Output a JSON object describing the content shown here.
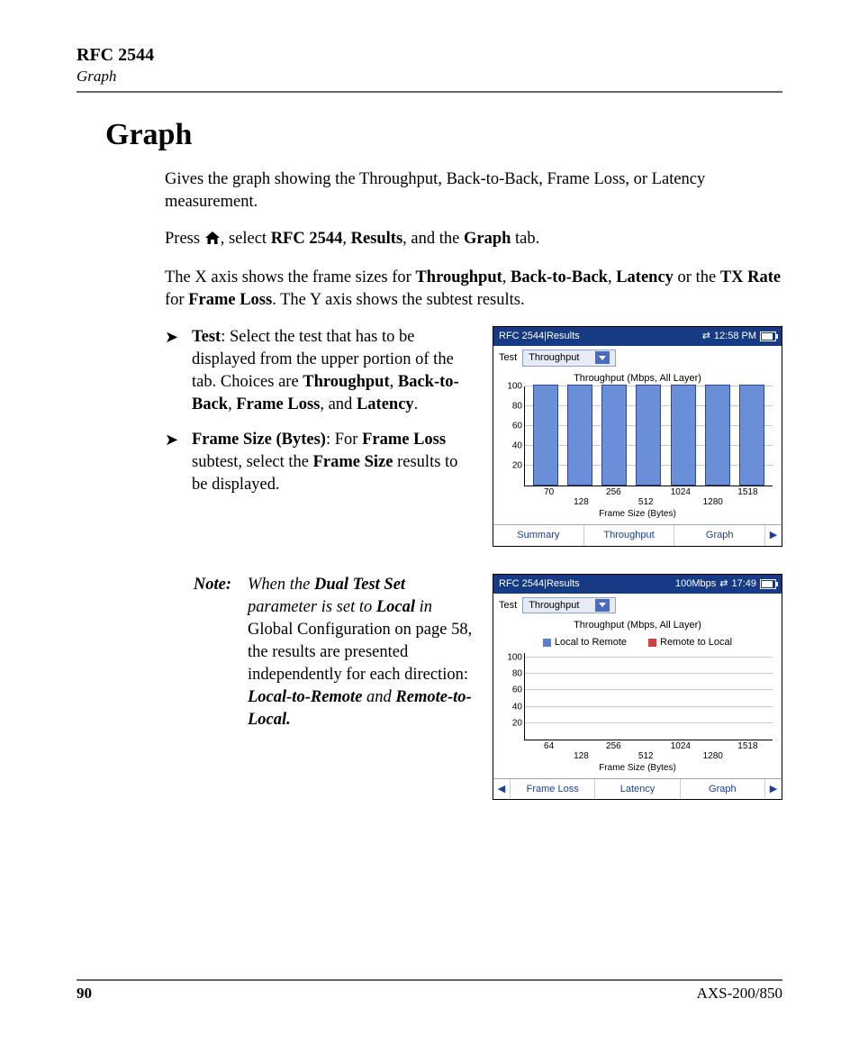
{
  "header": {
    "chapter": "RFC 2544",
    "sub": "Graph"
  },
  "title": "Graph",
  "intro": "Gives the graph showing the Throughput, Back-to-Back, Frame Loss, or Latency measurement.",
  "press": {
    "p1": "Press ",
    "p2": ", select ",
    "rfc": "RFC 2544",
    "c1": ", ",
    "res": "Results",
    "p3": ", and the ",
    "gr": "Graph",
    "p4": " tab."
  },
  "axis": {
    "a1": "The X axis shows the frame sizes for ",
    "t": "Throughput",
    "c1": ", ",
    "b": "Back-to-Back",
    "c2": ", ",
    "l": "Latency",
    "a2": " or the ",
    "tx": "TX Rate",
    "a3": " for ",
    "fl": "Frame Loss",
    "a4": ". The Y axis shows the subtest results."
  },
  "b1": {
    "h": "Test",
    "t1": ": Select the test that has to be displayed from the upper portion of the tab. Choices are ",
    "o1": "Throughput",
    "c1": ", ",
    "o2": "Back-to-Back",
    "c2": ", ",
    "o3": "Frame Loss",
    "c3": ", and ",
    "o4": "Latency",
    "t2": "."
  },
  "b2": {
    "h": "Frame Size (Bytes)",
    "t1": ": For ",
    "o1": "Frame Loss",
    "t2": " subtest, select the ",
    "o2": "Frame Size",
    "t3": " results to be displayed."
  },
  "note": {
    "label": "Note:",
    "n1": "When the ",
    "dts": "Dual Test Set",
    "n2": " parameter is set to ",
    "loc": "Local",
    "n3": " in ",
    "gcfg": "Global Configuration",
    "n4": " on page 58, the results are presented independently for each direction: ",
    "d1": "Local-to-Remote",
    "n5": " and ",
    "d2": "Remote-to-Local."
  },
  "footer": {
    "page": "90",
    "prod": "AXS-200/850"
  },
  "colors": {
    "local": "#5a7fd0",
    "remote": "#d04040"
  },
  "chart_data": [
    {
      "type": "bar",
      "title_bar": "RFC 2544|Results",
      "clock": "12:58 PM",
      "dropdown_label": "Test",
      "dropdown_value": "Throughput",
      "chart_title": "Throughput (Mbps, All Layer)",
      "y_ticks": [
        20,
        40,
        60,
        80,
        100
      ],
      "ylim": [
        0,
        100
      ],
      "categories": [
        "70",
        "128",
        "256",
        "512",
        "1024",
        "1280",
        "1518"
      ],
      "values": [
        100,
        100,
        100,
        100,
        100,
        100,
        100
      ],
      "xlabel": "Frame Size (Bytes)",
      "tabs": [
        "Summary",
        "Throughput",
        "Graph"
      ],
      "arrow": "right"
    },
    {
      "type": "bar",
      "title_bar": "RFC 2544|Results",
      "status": "100Mbps",
      "clock": "17:49",
      "dropdown_label": "Test",
      "dropdown_value": "Throughput",
      "chart_title": "Throughput (Mbps, All Layer)",
      "legend": [
        "Local to Remote",
        "Remote to Local"
      ],
      "y_ticks": [
        20,
        40,
        60,
        80,
        100
      ],
      "ylim": [
        0,
        105
      ],
      "categories": [
        "64",
        "128",
        "256",
        "512",
        "1024",
        "1280",
        "1518"
      ],
      "series": [
        {
          "name": "Local to Remote",
          "values": [
            null,
            null,
            null,
            null,
            null,
            null,
            null
          ]
        },
        {
          "name": "Remote to Local",
          "values": [
            null,
            null,
            null,
            null,
            null,
            null,
            null
          ]
        }
      ],
      "xlabel": "Frame Size (Bytes)",
      "tabs": [
        "Frame Loss",
        "Latency",
        "Graph"
      ],
      "arrow": "both"
    }
  ]
}
